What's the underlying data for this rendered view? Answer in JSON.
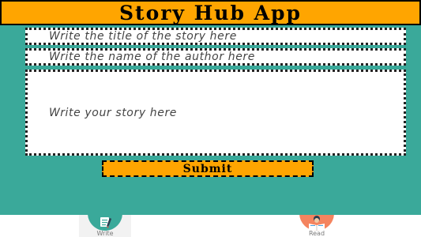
{
  "header": {
    "title": "Story Hub App"
  },
  "form": {
    "title_placeholder": "Write the title of the story here",
    "author_placeholder": "Write the name of the author here",
    "story_placeholder": "Write your story here",
    "submit_label": "Submit"
  },
  "tabs": [
    {
      "label": "Write",
      "icon": "write-icon",
      "active": true
    },
    {
      "label": "Read",
      "icon": "read-icon",
      "active": false
    }
  ],
  "colors": {
    "background": "#3aa99a",
    "accent": "#ffa500",
    "field_bg": "#ffffff",
    "tab_bar_bg": "#ffffff"
  }
}
